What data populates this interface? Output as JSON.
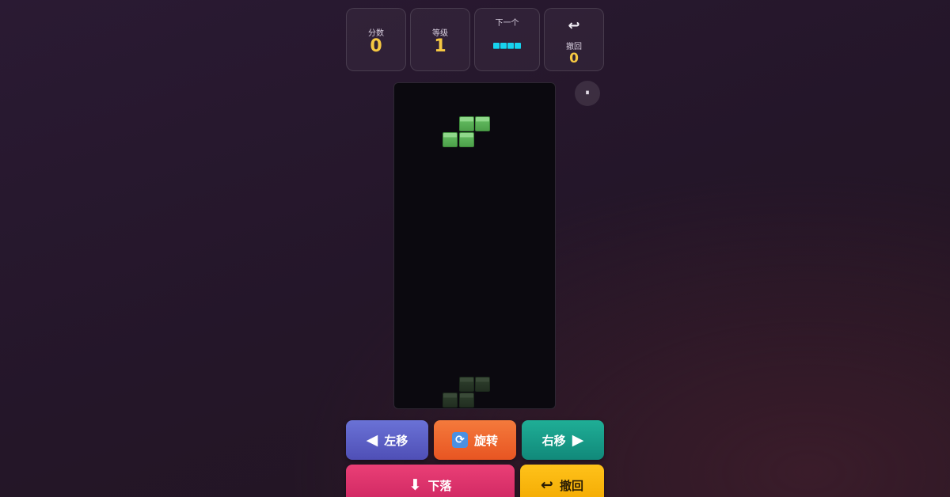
{
  "stats": {
    "score_label": "分数",
    "score_value": "0",
    "level_label": "等级",
    "level_value": "1",
    "next_label": "下一个",
    "next_piece": "I",
    "undo_icon": "↩",
    "undo_label": "撤回",
    "undo_value": "0"
  },
  "colors": {
    "accent_value": "#f5c842",
    "next_piece_color": "#17d3ee",
    "active_piece_color": "#5fb65c",
    "btn_left": "#5b5fc7",
    "btn_rotate": "#ee6a2f",
    "btn_right": "#17a08b",
    "btn_drop": "#e0336d",
    "btn_undo": "#fbb80f"
  },
  "board": {
    "active_piece": "S",
    "ghost_piece": "S"
  },
  "pause_icon": "⏸",
  "controls": {
    "left_icon": "◀",
    "left_label": "左移",
    "rotate_icon": "🔄",
    "rotate_label": "旋转",
    "right_label": "右移",
    "right_icon": "▶",
    "drop_icon": "⬇",
    "drop_label": "下落",
    "undo_icon": "↩",
    "undo_label": "撤回"
  }
}
